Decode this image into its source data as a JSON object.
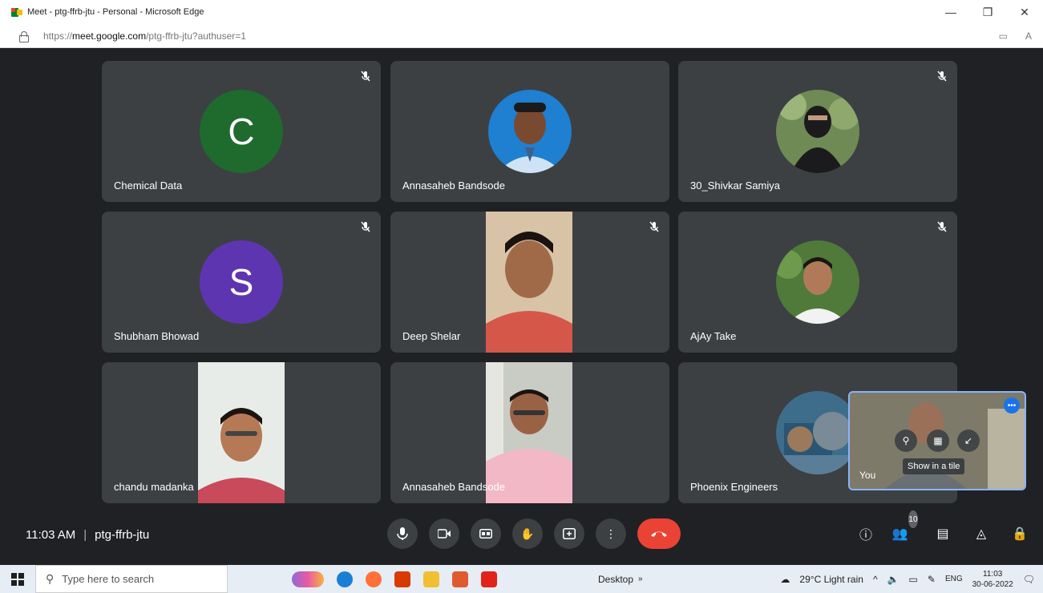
{
  "browser": {
    "title": "Meet - ptg-ffrb-jtu - Personal - Microsoft Edge",
    "url_prefix": "https://",
    "url_host": "meet.google.com",
    "url_path": "/ptg-ffrb-jtu?authuser=1"
  },
  "tiles": [
    {
      "name": "Chemical Data",
      "letter": "C",
      "avatar_color": "#1e6b2d",
      "muted": true
    },
    {
      "name": "Annasaheb Bandsode",
      "muted": false
    },
    {
      "name": "30_Shivkar Samiya",
      "muted": true
    },
    {
      "name": "Shubham Bhowad",
      "letter": "S",
      "avatar_color": "#5e35b1",
      "muted": true
    },
    {
      "name": "Deep Shelar",
      "muted": true
    },
    {
      "name": "AjAy Take",
      "muted": true
    },
    {
      "name": "chandu madanka",
      "muted": false
    },
    {
      "name": "Annasaheb Bandsode",
      "muted": false
    },
    {
      "name": "Phoenix Engineers",
      "muted": false
    }
  ],
  "self_view": {
    "label": "You",
    "tooltip": "Show in a tile"
  },
  "bottom": {
    "time": "11:03 AM",
    "meeting_code": "ptg-ffrb-jtu",
    "people_count": "10"
  },
  "taskbar": {
    "search_placeholder": "Type here to search",
    "desktop_label": "Desktop",
    "weather": "29°C  Light rain",
    "lang": "ENG",
    "clock_time": "11:03",
    "clock_date": "30-06-2022"
  },
  "colors": {
    "end_call": "#ea4335",
    "tile_bg": "#3c4043",
    "stage_bg": "#202124",
    "self_border": "#8ab4f8"
  }
}
